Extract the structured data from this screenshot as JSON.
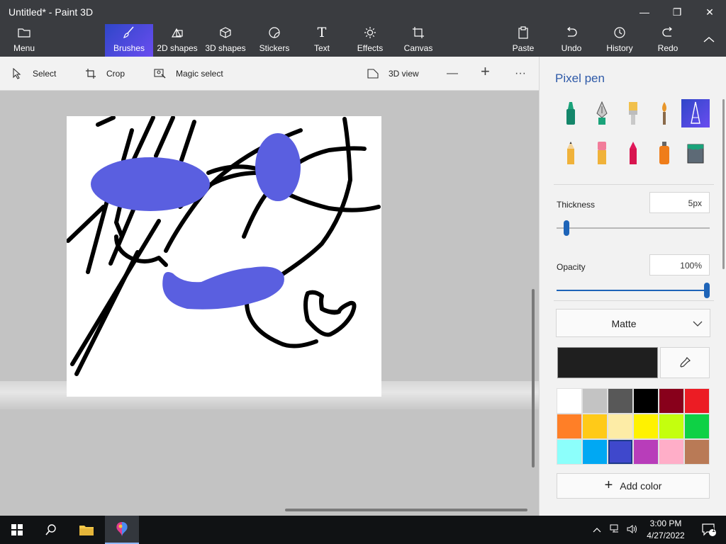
{
  "window": {
    "title": "Untitled* - Paint 3D",
    "minimize_glyph": "—",
    "restore_glyph": "❐",
    "close_glyph": "✕"
  },
  "ribbon": {
    "menu": "Menu",
    "tools": {
      "brushes": "Brushes",
      "shapes2d": "2D shapes",
      "shapes3d": "3D shapes",
      "stickers": "Stickers",
      "text": "Text",
      "effects": "Effects",
      "canvas": "Canvas"
    },
    "paste": "Paste",
    "undo": "Undo",
    "history": "History",
    "redo": "Redo",
    "text_glyph": "T"
  },
  "toolbar": {
    "select": "Select",
    "crop": "Crop",
    "magic_select": "Magic select",
    "view3d": "3D view",
    "zoom_out_glyph": "—",
    "zoom_in_glyph": "+",
    "more_glyph": "···"
  },
  "panel": {
    "title": "Pixel pen",
    "brushes": [
      {
        "name": "marker",
        "selected": false
      },
      {
        "name": "calligraphy-pen",
        "selected": false
      },
      {
        "name": "oil-brush",
        "selected": false
      },
      {
        "name": "watercolor",
        "selected": false
      },
      {
        "name": "pixel-pen",
        "selected": true
      },
      {
        "name": "pencil",
        "selected": false
      },
      {
        "name": "eraser",
        "selected": false
      },
      {
        "name": "crayon",
        "selected": false
      },
      {
        "name": "spray-can",
        "selected": false
      },
      {
        "name": "fill",
        "selected": false
      }
    ],
    "thickness_label": "Thickness",
    "thickness_value": "5px",
    "thickness_level": 0.05,
    "opacity_label": "Opacity",
    "opacity_value": "100%",
    "opacity_level": 1.0,
    "finish": "Matte",
    "current_color": "#1f1f1f",
    "palette": [
      "#ffffff",
      "#c3c3c3",
      "#585858",
      "#000000",
      "#88001b",
      "#ec1c24",
      "#ff7f27",
      "#ffca18",
      "#fdeca6",
      "#fff200",
      "#c4ff0e",
      "#0ed145",
      "#8cfffb",
      "#00a8f3",
      "#3f48cc",
      "#b83dba",
      "#ffaec8",
      "#b97a56"
    ],
    "palette_selected_index": 14,
    "add_color": "Add color"
  },
  "colors": {
    "accent": "#2f5aa8",
    "blob": "#5a5fe0",
    "ink": "#000000"
  },
  "taskbar": {
    "time": "3:00 PM",
    "date": "4/27/2022",
    "notifications": "1"
  }
}
